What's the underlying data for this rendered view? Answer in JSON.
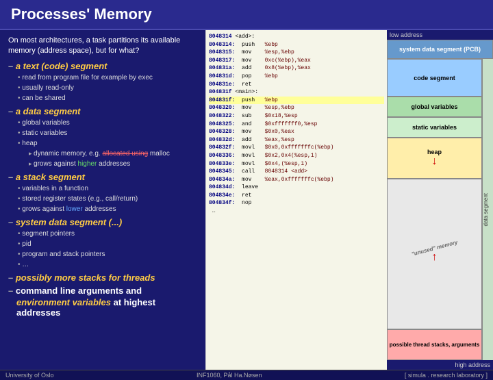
{
  "header": {
    "title": "Processes' Memory"
  },
  "intro": {
    "text": "On most architectures, a task partitions its available memory (address space), but for what?",
    "low_address": "low address"
  },
  "sections": [
    {
      "id": "text",
      "dash": "–",
      "prefix": "a",
      "name": "text (code) segment",
      "bullets": [
        "read from program file for example by exec",
        "usually read-only",
        "can be shared"
      ]
    },
    {
      "id": "data",
      "dash": "–",
      "prefix": "a",
      "name": "data segment",
      "bullets": [
        "global variables",
        "static variables",
        "heap"
      ],
      "sub_bullets": [
        "dynamic memory, e.g. allocated using malloc",
        "grows against higher addresses"
      ]
    },
    {
      "id": "stack",
      "dash": "–",
      "prefix": "a",
      "name": "stack segment",
      "bullets": [
        "variables in a function",
        "stored register states (e.g., call/return)",
        "grows against lower addresses"
      ]
    },
    {
      "id": "system",
      "dash": "–",
      "prefix": "system",
      "name": "data segment (...)",
      "bullets": [
        "segment pointers",
        "pid",
        "program and stack pointers",
        "…"
      ]
    },
    {
      "id": "threads",
      "dash": "–",
      "label": "possibly more stacks for threads"
    },
    {
      "id": "cmdline",
      "dash": "–",
      "label_normal": "command line arguments and",
      "label_bold": "environment variables at highest addresses"
    }
  ],
  "code_lines": [
    {
      "addr": "8048314",
      "label": "<add>:",
      "instr": "",
      "operand": ""
    },
    {
      "addr": "8048314:",
      "label": "",
      "instr": "push",
      "operand": "%ebp"
    },
    {
      "addr": "8048315:",
      "label": "",
      "instr": "mov",
      "operand": "%esp,%ebp"
    },
    {
      "addr": "8048317:",
      "label": "",
      "instr": "mov",
      "operand": "0xc(%ebp),%eax"
    },
    {
      "addr": "804831a:",
      "label": "",
      "instr": "add",
      "operand": "0x8(%ebp),%eax"
    },
    {
      "addr": "804831d:",
      "label": "",
      "instr": "pop",
      "operand": "%ebp"
    },
    {
      "addr": "804831e:",
      "label": "",
      "instr": "ret",
      "operand": ""
    },
    {
      "addr": "804831f",
      "label": "<main>:",
      "instr": "",
      "operand": ""
    },
    {
      "addr": "804831f:",
      "label": "",
      "instr": "push",
      "operand": "%ebp",
      "highlight": true
    },
    {
      "addr": "8048320:",
      "label": "",
      "instr": "mov",
      "operand": "%esp,%ebp"
    },
    {
      "addr": "8048322:",
      "label": "",
      "instr": "sub",
      "operand": "$0x18,%esp"
    },
    {
      "addr": "8048325:",
      "label": "",
      "instr": "and",
      "operand": "$0xfffffff0,%esp"
    },
    {
      "addr": "8048328:",
      "label": "",
      "instr": "mov",
      "operand": "$0x0,%eax"
    },
    {
      "addr": "804832d:",
      "label": "",
      "instr": "add",
      "operand": "%eax,%esp"
    },
    {
      "addr": "804832f:",
      "label": "",
      "instr": "movl",
      "operand": "$0x0,0xfffffffc(%ebp)"
    },
    {
      "addr": "8048336:",
      "label": "",
      "instr": "movl",
      "operand": "$0x2,0x4(%esp,1)"
    },
    {
      "addr": "804833e:",
      "label": "",
      "instr": "movl",
      "operand": "$0x4,(%esp,1)"
    },
    {
      "addr": "8048345:",
      "label": "",
      "instr": "call",
      "operand": "8048314 <add>"
    },
    {
      "addr": "804834a:",
      "label": "",
      "instr": "mov",
      "operand": "%eax,0xfffffffc(%ebp)"
    },
    {
      "addr": "804834d:",
      "label": "",
      "instr": "leave",
      "operand": ""
    },
    {
      "addr": "804834e:",
      "label": "",
      "instr": "ret",
      "operand": ""
    },
    {
      "addr": "804834f:",
      "label": "",
      "instr": "nop",
      "operand": ""
    },
    {
      "addr": "…",
      "label": "",
      "instr": "",
      "operand": ""
    }
  ],
  "memory_segments": [
    {
      "id": "pcb",
      "label": "system data segment (PCB)",
      "color": "#6699cc",
      "text_color": "white"
    },
    {
      "id": "code",
      "label": "code segment",
      "color": "#99ccff",
      "text_color": "#000"
    },
    {
      "id": "global",
      "label": "global variables",
      "color": "#aaddaa",
      "text_color": "#000"
    },
    {
      "id": "static",
      "label": "static variables",
      "color": "#cceecc",
      "text_color": "#000"
    },
    {
      "id": "heap",
      "label": "heap",
      "color": "#ffeeaa",
      "text_color": "#000"
    },
    {
      "id": "unused",
      "label": "'unused' memory",
      "color": "#e8e8e8",
      "text_color": "#888"
    },
    {
      "id": "thread",
      "label": "possible thread stacks, arguments",
      "color": "#ffaaaa",
      "text_color": "#000"
    }
  ],
  "labels": {
    "data_segment": "data segment",
    "high_address": "high address",
    "low_address": "low address"
  },
  "footer": {
    "university": "University of Oslo",
    "course": "INF1060,  Pål Ha.Nøsen",
    "logo": "[ simula . research laboratory ]"
  }
}
